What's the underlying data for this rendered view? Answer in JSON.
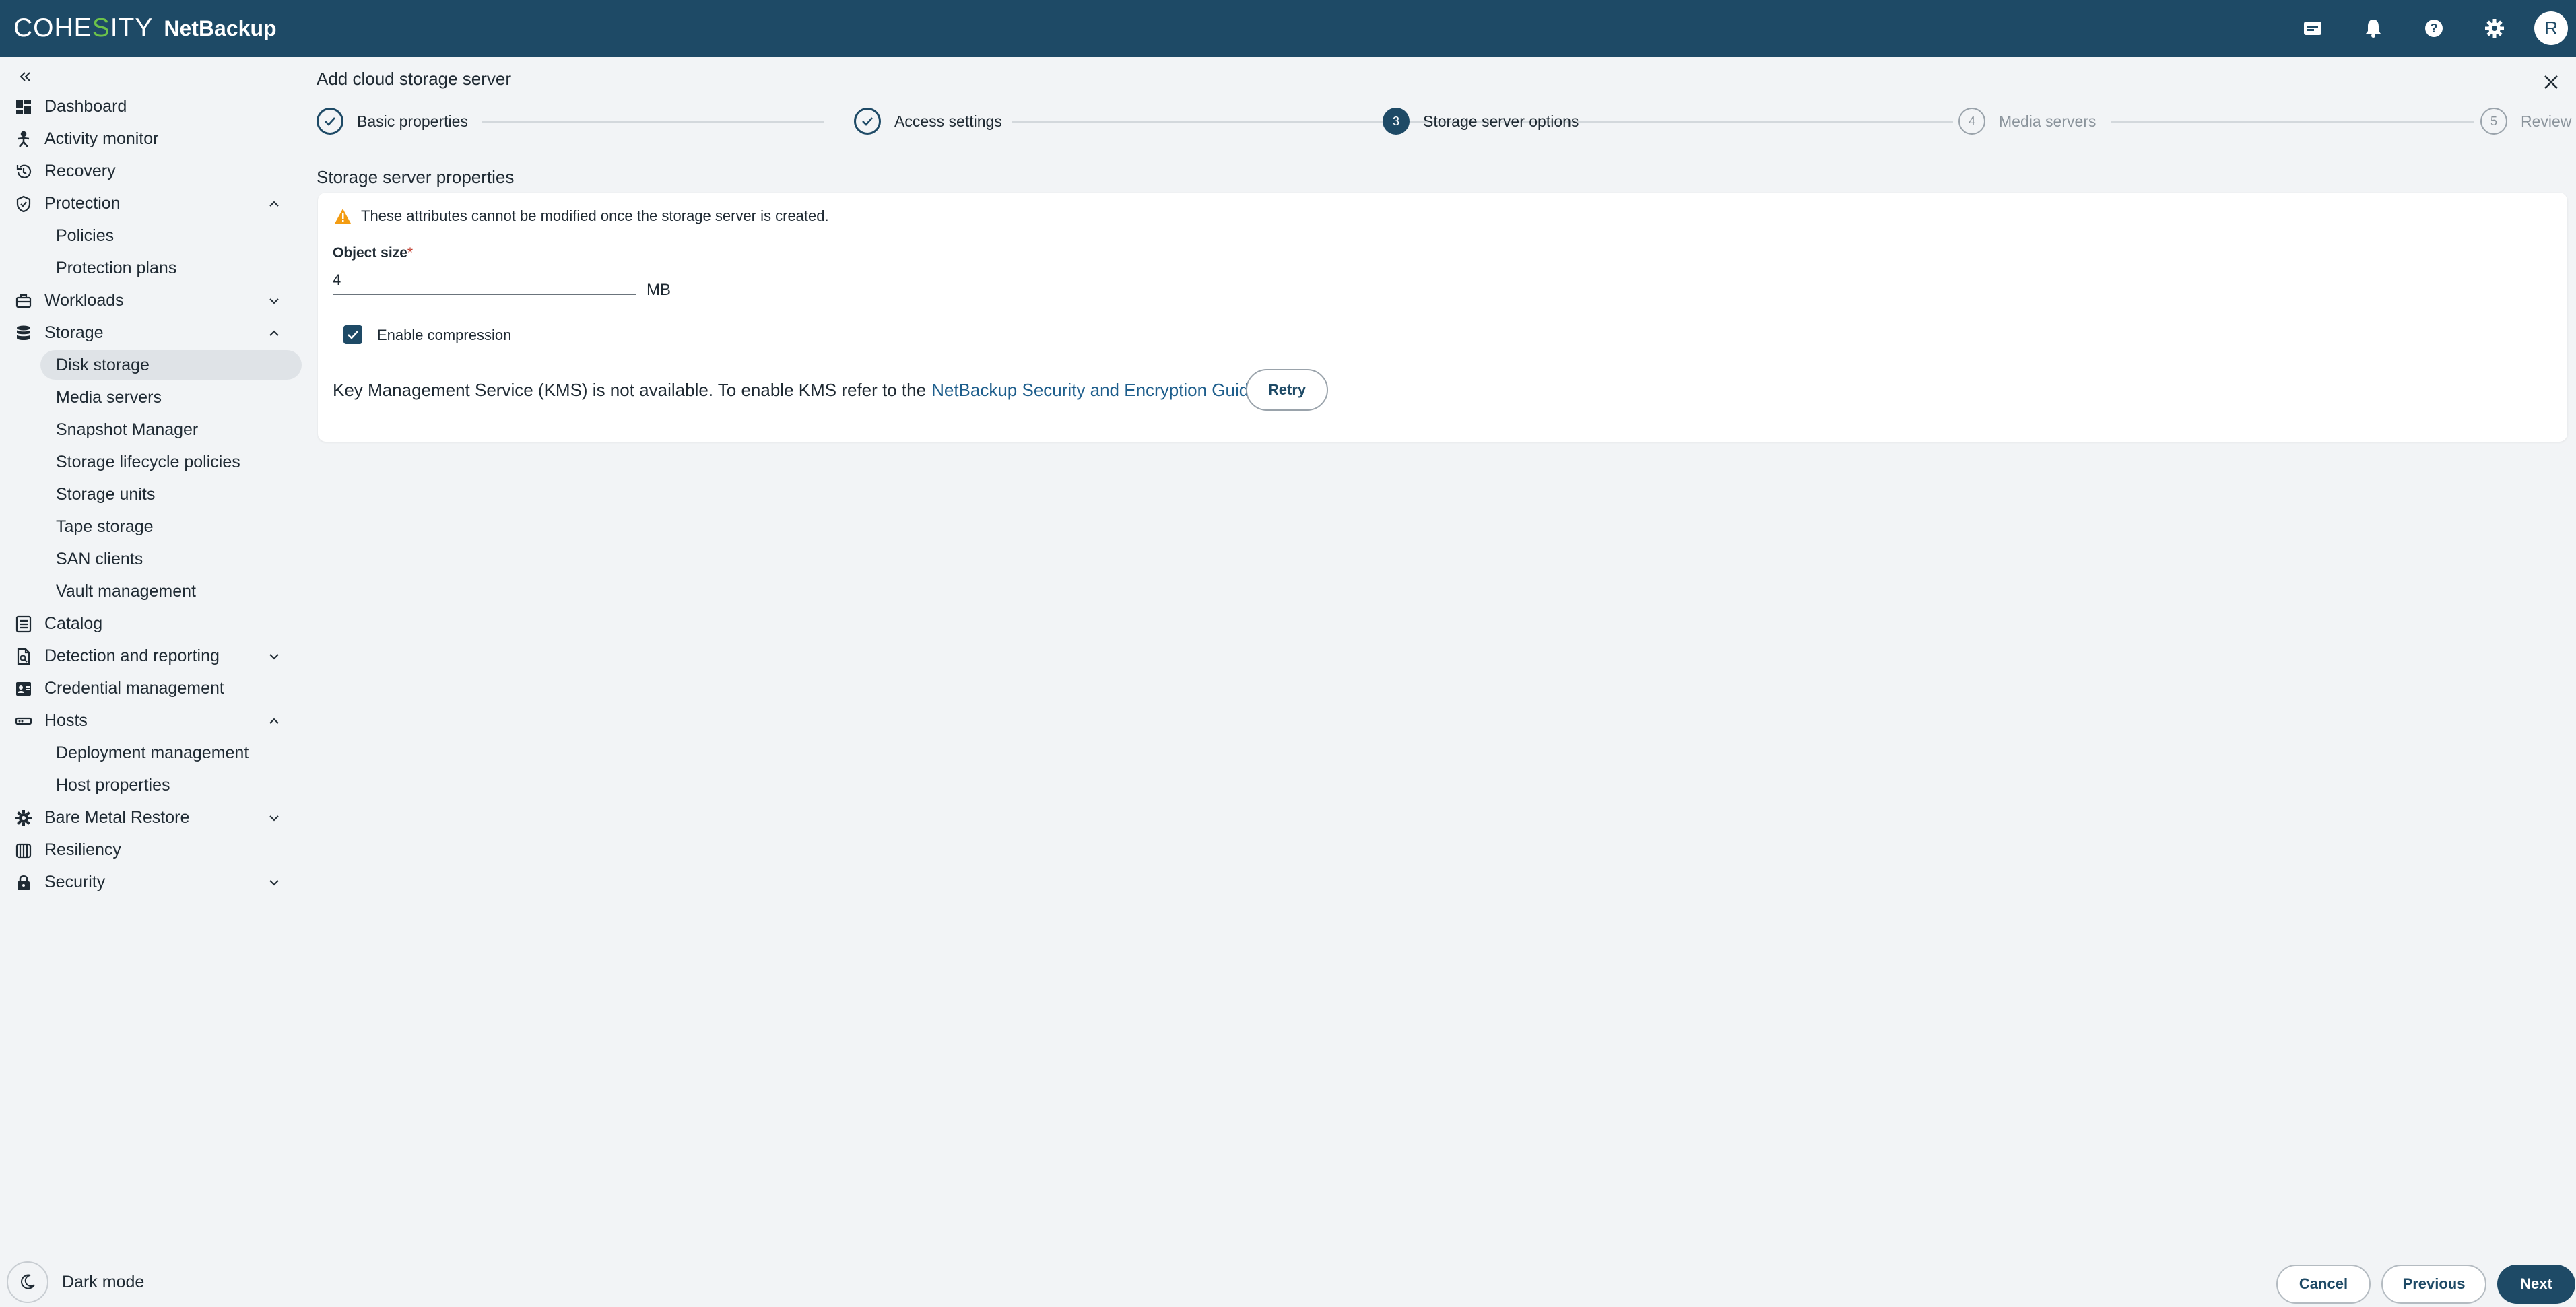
{
  "header": {
    "brand_pre": "COHE",
    "brand_accent": "S",
    "brand_post": "ITY",
    "product": "NetBackup",
    "icons": [
      "announcement-icon",
      "bell-icon",
      "help-icon",
      "gear-icon"
    ],
    "avatar_initial": "R",
    "bg_color": "#1e4a66",
    "brand_accent_color": "#6cc24a"
  },
  "sidebar": {
    "items": [
      {
        "label": "Dashboard",
        "icon": "dashboard-icon"
      },
      {
        "label": "Activity monitor",
        "icon": "activity-icon"
      },
      {
        "label": "Recovery",
        "icon": "recovery-icon"
      },
      {
        "label": "Protection",
        "icon": "shield-icon",
        "expanded": true,
        "children": [
          "Policies",
          "Protection plans"
        ]
      },
      {
        "label": "Workloads",
        "icon": "briefcase-icon",
        "expanded": false
      },
      {
        "label": "Storage",
        "icon": "database-icon",
        "expanded": true,
        "children": [
          "Disk storage",
          "Media servers",
          "Snapshot Manager",
          "Storage lifecycle policies",
          "Storage units",
          "Tape storage",
          "SAN clients",
          "Vault management"
        ],
        "active_child": "Disk storage"
      },
      {
        "label": "Catalog",
        "icon": "catalog-icon"
      },
      {
        "label": "Detection and reporting",
        "icon": "report-icon",
        "expanded": false
      },
      {
        "label": "Credential management",
        "icon": "credential-icon"
      },
      {
        "label": "Hosts",
        "icon": "host-icon",
        "expanded": true,
        "children": [
          "Deployment management",
          "Host properties"
        ]
      },
      {
        "label": "Bare Metal Restore",
        "icon": "bmr-icon",
        "expanded": false
      },
      {
        "label": "Resiliency",
        "icon": "resiliency-icon"
      },
      {
        "label": "Security",
        "icon": "lock-icon",
        "expanded": false
      }
    ],
    "dark_mode_label": "Dark mode"
  },
  "wizard": {
    "title": "Add cloud storage server",
    "steps": [
      {
        "number": "1",
        "label": "Basic properties",
        "state": "complete"
      },
      {
        "number": "2",
        "label": "Access settings",
        "state": "complete"
      },
      {
        "number": "3",
        "label": "Storage server options",
        "state": "current"
      },
      {
        "number": "4",
        "label": "Media servers",
        "state": "pending"
      },
      {
        "number": "5",
        "label": "Review",
        "state": "pending"
      }
    ]
  },
  "section": {
    "title": "Storage server properties",
    "warning": "These attributes cannot be modified once the storage server is created.",
    "object_size_label": "Object size",
    "required_mark": "*",
    "object_size_value": "4",
    "object_size_unit": "MB",
    "compression_label": "Enable compression",
    "compression_checked": true,
    "kms_text": "Key Management Service (KMS) is not available. To enable KMS refer to the",
    "kms_link": "NetBackup Security and Encryption Guide.",
    "retry_label": "Retry"
  },
  "footer": {
    "cancel": "Cancel",
    "previous": "Previous",
    "next": "Next"
  }
}
